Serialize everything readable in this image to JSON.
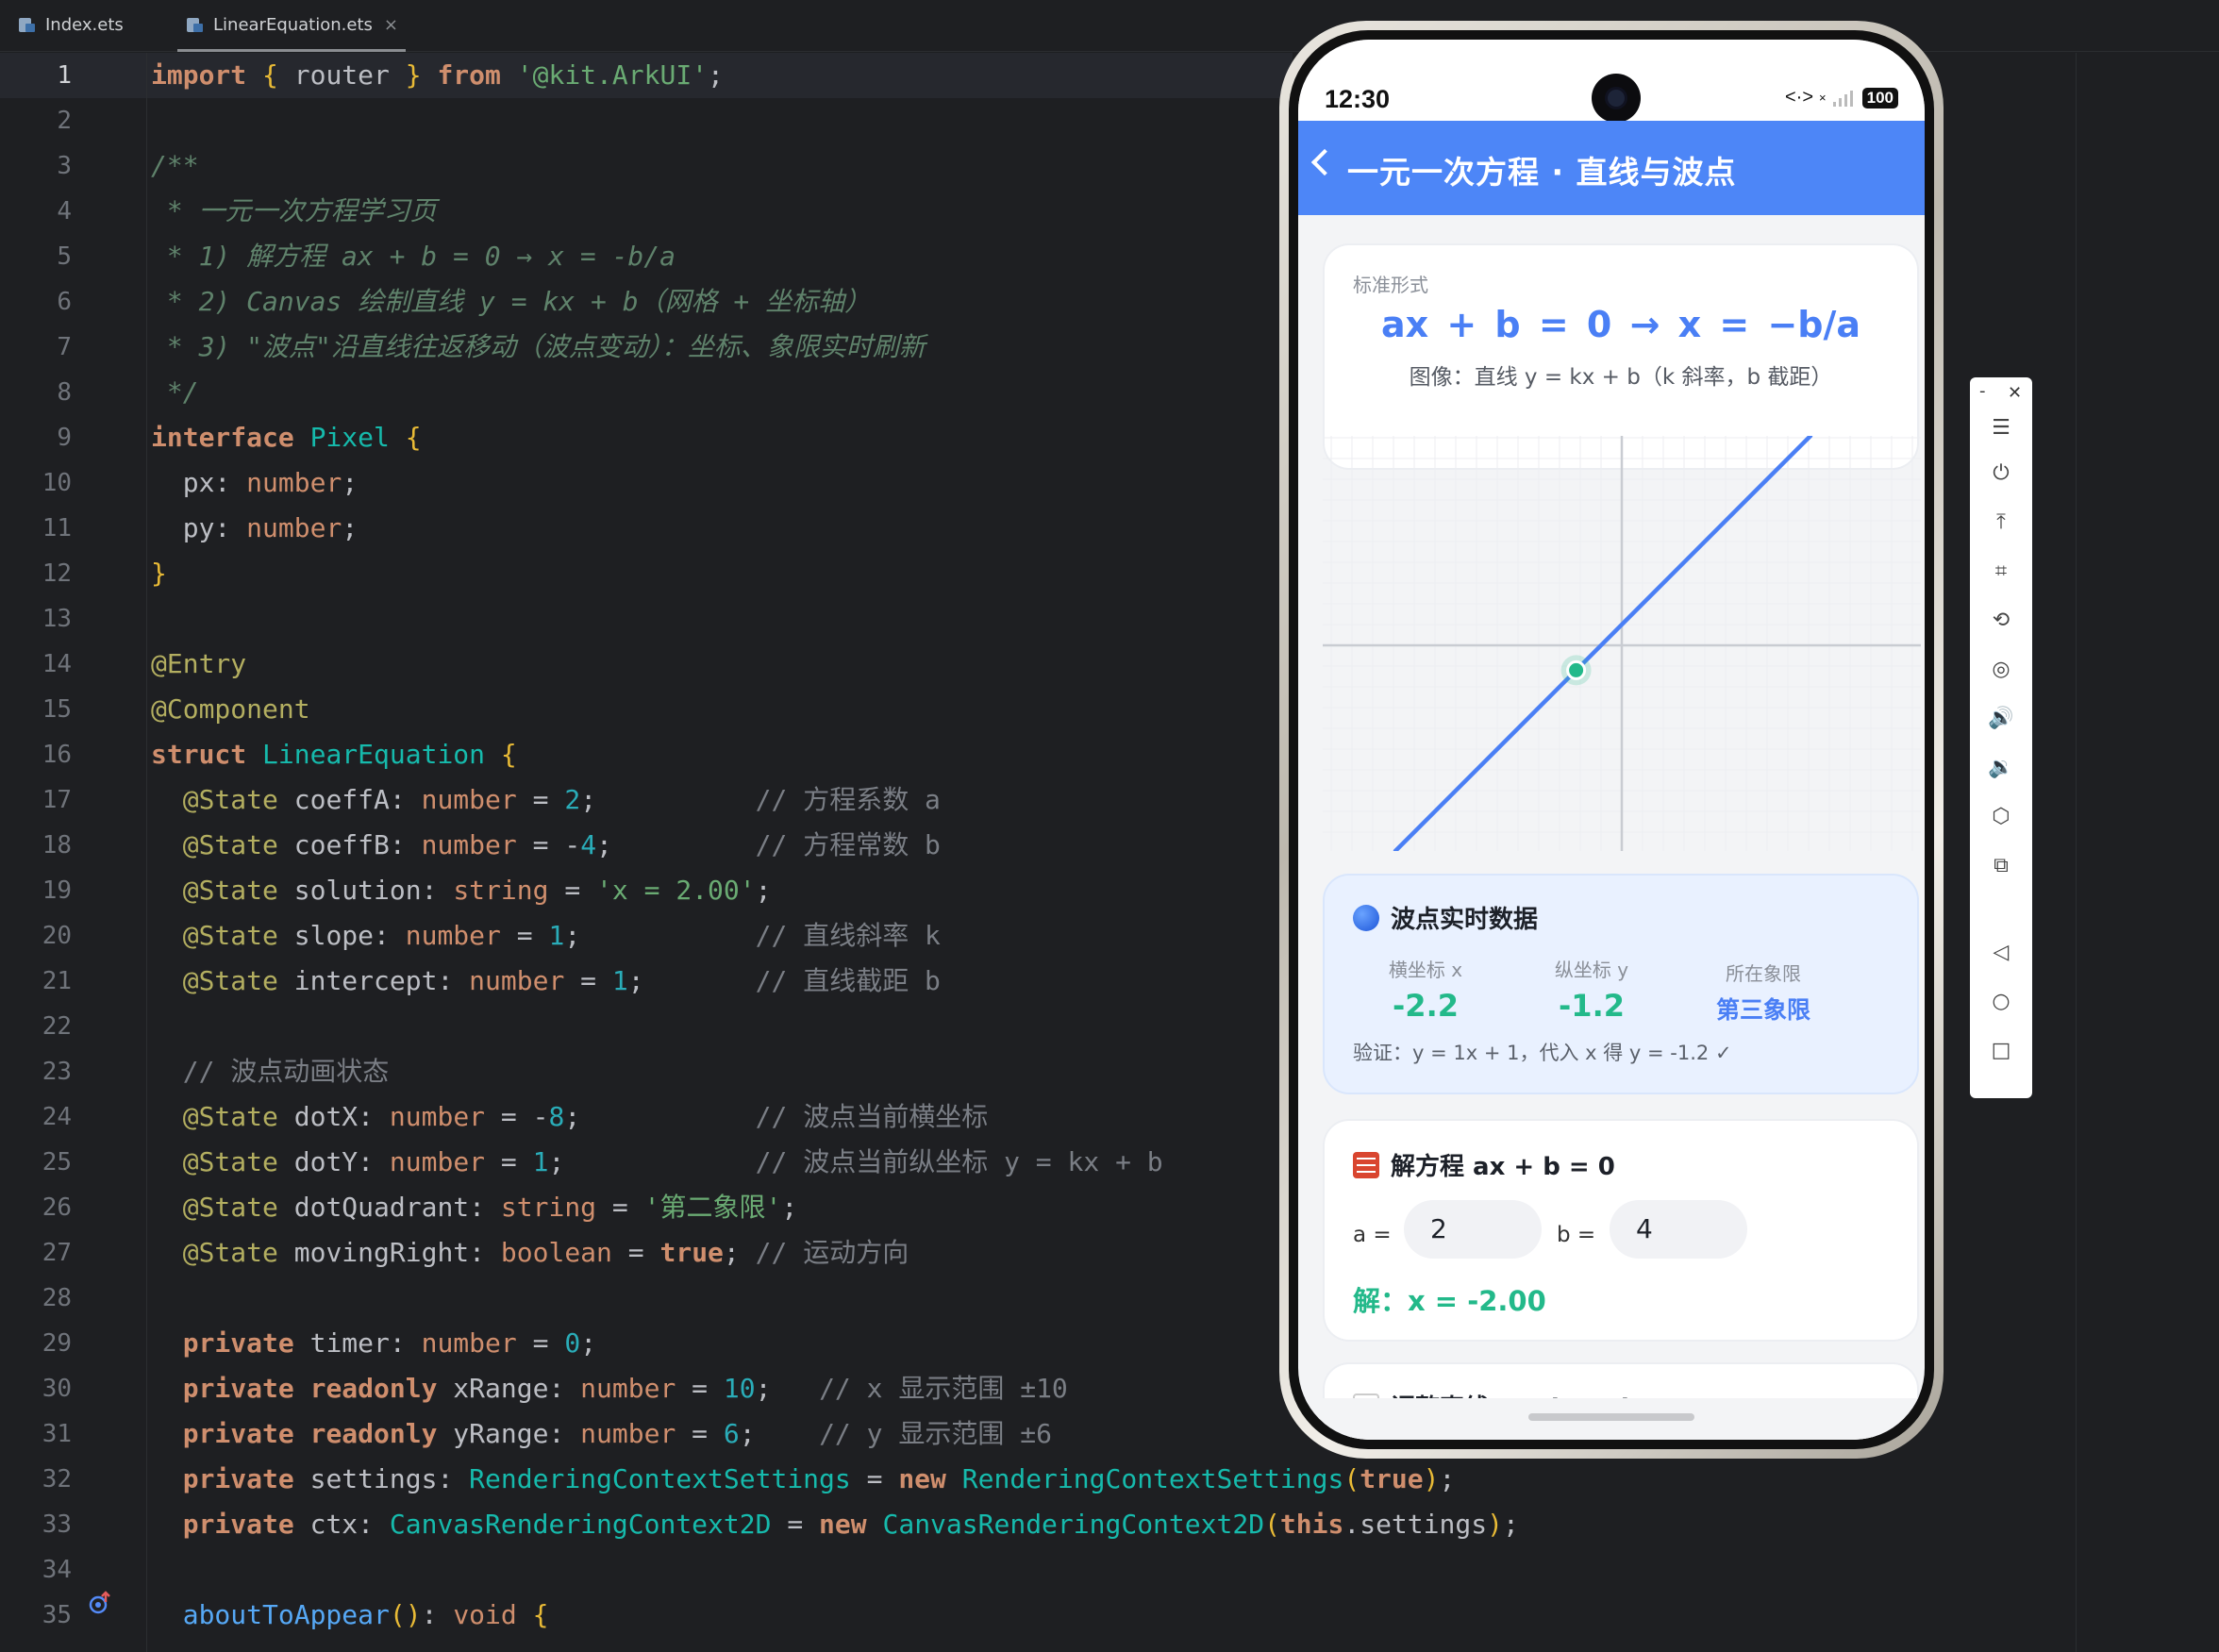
{
  "tabs": [
    {
      "label": "Index.ets"
    },
    {
      "label": "LinearEquation.ets",
      "close": "×"
    }
  ],
  "editor": {
    "current_line": 1,
    "line_numbers": [
      "1",
      "2",
      "3",
      "4",
      "5",
      "6",
      "7",
      "8",
      "9",
      "10",
      "11",
      "12",
      "13",
      "14",
      "15",
      "16",
      "17",
      "18",
      "19",
      "20",
      "21",
      "22",
      "23",
      "24",
      "25",
      "26",
      "27",
      "28",
      "29",
      "30",
      "31",
      "32",
      "33",
      "34",
      "35"
    ],
    "code_lines": [
      "import { router } from '@kit.ArkUI';",
      "",
      "/**",
      " * 一元一次方程学习页",
      " * 1) 解方程 ax + b = 0 → x = -b/a",
      " * 2) Canvas 绘制直线 y = kx + b（网格 + 坐标轴）",
      " * 3) \"波点\"沿直线往返移动（波点变动）：坐标、象限实时刷新",
      " */",
      "interface Pixel {",
      "  px: number;",
      "  py: number;",
      "}",
      "",
      "@Entry",
      "@Component",
      "struct LinearEquation {",
      "  @State coeffA: number = 2;          // 方程系数 a",
      "  @State coeffB: number = -4;         // 方程常数 b",
      "  @State solution: string = 'x = 2.00';",
      "  @State slope: number = 1;           // 直线斜率 k",
      "  @State intercept: number = 1;       // 直线截距 b",
      "",
      "  // 波点动画状态",
      "  @State dotX: number = -8;           // 波点当前横坐标",
      "  @State dotY: number = 1;            // 波点当前纵坐标 y = kx + b",
      "  @State dotQuadrant: string = '第二象限';",
      "  @State movingRight: boolean = true; // 运动方向",
      "",
      "  private timer: number = 0;",
      "  private readonly xRange: number = 10;   // x 显示范围 ±10",
      "  private readonly yRange: number = 6;    // y 显示范围 ±6",
      "  private settings: RenderingContextSettings = new RenderingContextSettings(true);",
      "  private ctx: CanvasRenderingContext2D = new CanvasRenderingContext2D(this.settings);",
      "",
      "  aboutToAppear(): void {"
    ]
  },
  "device": {
    "status": {
      "time": "12:30",
      "battery": "100",
      "network": "<·>",
      "signal_x": "×"
    },
    "nav": {
      "title": "一元一次方程 · 直线与波点"
    },
    "formula_card": {
      "label": "标准形式",
      "formula": "ax + b = 0   →   x = −b/a",
      "sub": "图像：直线 y = kx + b（k 斜率，b 截距）"
    },
    "graph": {
      "slope": 1,
      "intercept": 1,
      "dot": {
        "x": -2.2,
        "y": -1.2
      },
      "x_range": 10,
      "y_range": 6
    },
    "data_card": {
      "title": "波点实时数据",
      "x_label": "横坐标 x",
      "x_value": "-2.2",
      "y_label": "纵坐标 y",
      "y_value": "-1.2",
      "q_label": "所在象限",
      "q_value": "第三象限",
      "verify": "验证：y = 1x + 1，代入 x 得 y = -1.2 ✓"
    },
    "solve_card": {
      "title": "解方程 ax + b = 0",
      "a_label": "a =",
      "a_value": "2",
      "b_label": "b =",
      "b_value": "4",
      "solution": "解：x = -2.00"
    },
    "next_card": {
      "title": "调整直线 y = kx + b"
    }
  },
  "colors": {
    "accent": "#4d86f7",
    "success": "#23b98a",
    "editor_bg": "#1e1f22"
  },
  "side_toolbar": {
    "buttons": [
      "menu-icon",
      "power-icon",
      "pin-top-icon",
      "crop-icon",
      "rotate-icon",
      "screenshot-icon",
      "volume-up-icon",
      "volume-down-icon",
      "shake-icon",
      "multi-device-icon",
      "back-icon",
      "home-icon",
      "recents-icon"
    ]
  }
}
